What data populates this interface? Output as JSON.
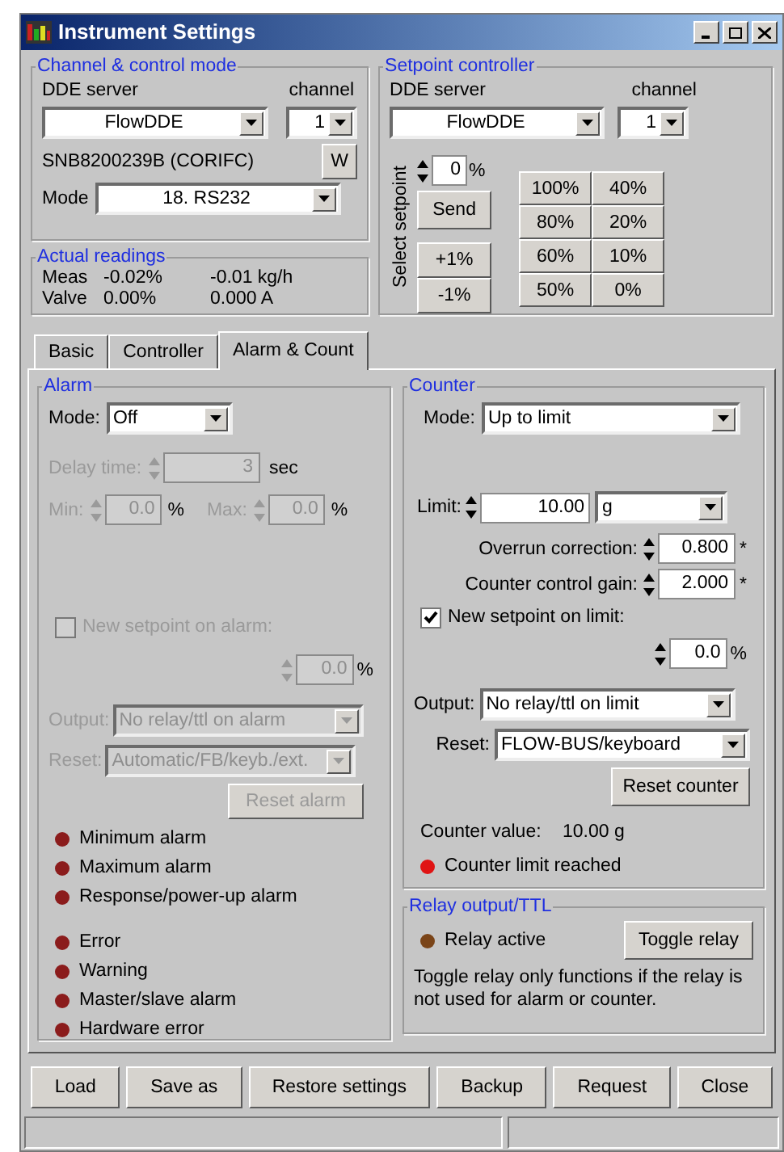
{
  "window": {
    "title": "Instrument Settings"
  },
  "channel_control": {
    "title": "Channel & control mode",
    "dde_label": "DDE server",
    "channel_label": "channel",
    "dde_server": "FlowDDE",
    "channel": "1",
    "serial": "SNB8200239B (CORIFC)",
    "w_button": "W",
    "mode_label": "Mode",
    "mode": "18. RS232"
  },
  "actual_readings": {
    "title": "Actual readings",
    "rows": [
      {
        "label": "Meas",
        "percent": "-0.02%",
        "value": "-0.01 kg/h"
      },
      {
        "label": "Valve",
        "percent": "0.00%",
        "value": "0.000 A"
      }
    ]
  },
  "setpoint_controller": {
    "title": "Setpoint controller",
    "dde_label": "DDE server",
    "channel_label": "channel",
    "dde_server": "FlowDDE",
    "channel": "1",
    "side_label": "Select setpoint",
    "setpoint": "0",
    "unit": "%",
    "send": "Send",
    "steps": [
      "+1%",
      "-1%"
    ],
    "presets": [
      "100%",
      "40%",
      "80%",
      "20%",
      "60%",
      "10%",
      "50%",
      "0%"
    ]
  },
  "tabs": [
    {
      "label": "Basic",
      "selected": false
    },
    {
      "label": "Controller",
      "selected": false
    },
    {
      "label": "Alarm & Count",
      "selected": true
    }
  ],
  "alarm": {
    "title": "Alarm",
    "disabled": true,
    "mode_label": "Mode:",
    "mode": "Off",
    "delay_label": "Delay time:",
    "delay": "3",
    "delay_unit": "sec",
    "min_label": "Min:",
    "min": "0.0",
    "min_unit": "%",
    "max_label": "Max:",
    "max": "0.0",
    "max_unit": "%",
    "new_setpoint": {
      "label": "New setpoint on alarm:",
      "checked": false
    },
    "setpoint": "0.0",
    "setpoint_unit": "%",
    "output_label": "Output:",
    "output": "No relay/ttl on alarm",
    "reset_label": "Reset:",
    "reset": "Automatic/FB/keyb./ext.",
    "reset_button": "Reset alarm",
    "alarm_indicators": [
      {
        "label": "Minimum alarm",
        "color": "#8b1c1c"
      },
      {
        "label": "Maximum alarm",
        "color": "#8b1c1c"
      },
      {
        "label": "Response/power-up alarm",
        "color": "#8b1c1c"
      }
    ],
    "status_indicators": [
      {
        "label": "Error",
        "color": "#8b1c1c"
      },
      {
        "label": "Warning",
        "color": "#8b1c1c"
      },
      {
        "label": "Master/slave alarm",
        "color": "#8b1c1c"
      },
      {
        "label": "Hardware error",
        "color": "#8b1c1c"
      }
    ]
  },
  "counter": {
    "title": "Counter",
    "mode_label": "Mode:",
    "mode": "Up to limit",
    "limit_label": "Limit:",
    "limit": "10.00",
    "limit_unit": "g",
    "overrun_label": "Overrun correction:",
    "overrun": "0.800",
    "overrun_mark": "*",
    "gain_label": "Counter control gain:",
    "gain": "2.000",
    "gain_mark": "*",
    "new_setpoint": {
      "label": "New setpoint on limit:",
      "checked": true
    },
    "setpoint": "0.0",
    "setpoint_unit": "%",
    "output_label": "Output:",
    "output": "No relay/ttl on limit",
    "reset_label": "Reset:",
    "reset": "FLOW-BUS/keyboard",
    "reset_button": "Reset counter",
    "value_label": "Counter value:",
    "value": "10.00 g",
    "indicator": {
      "label": "Counter limit reached",
      "color": "#e01414"
    }
  },
  "relay": {
    "title": "Relay output/TTL",
    "indicator": {
      "label": "Relay active",
      "color": "#7a4418"
    },
    "button": "Toggle relay",
    "note": "Toggle relay only functions if the relay is not used for alarm or counter."
  },
  "buttons": [
    "Load",
    "Save as",
    "Restore settings",
    "Backup",
    "Request",
    "Close"
  ]
}
